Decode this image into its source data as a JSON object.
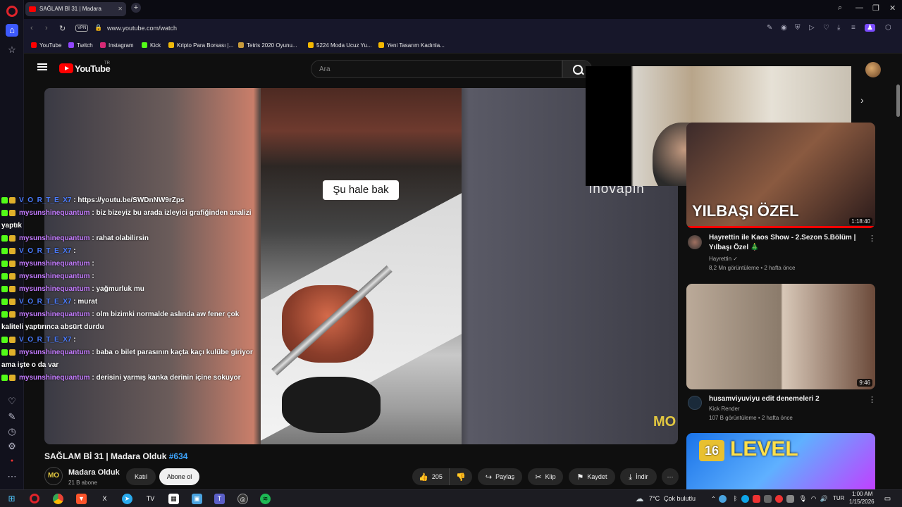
{
  "browser": {
    "tab_title": "SAĞLAM Bİ 31 | Madara",
    "url": "www.youtube.com/watch",
    "vpn": "VPN",
    "bookmarks": [
      "YouTube",
      "Twitch",
      "Instagram",
      "Kick",
      "Kripto Para Borsası |...",
      "Tetris 2020 Oyunu...",
      "5224 Moda Ucuz Yu...",
      "Yeni Tasarım Kadınla..."
    ]
  },
  "youtube": {
    "logo": "YouTube",
    "country": "TR",
    "search_placeholder": "Ara"
  },
  "video": {
    "caption": "Şu hale bak",
    "overlay_brand": "inovapin",
    "watermark": "MO",
    "title": "SAĞLAM Bİ 31 | Madara Olduk",
    "title_tag": "#634",
    "channel_name": "Madara Olduk",
    "channel_logo": "MO",
    "subscribers": "21 B abone",
    "join": "Katıl",
    "subscribe": "Abone ol",
    "likes": "205",
    "share": "Paylaş",
    "clip": "Klip",
    "save": "Kaydet",
    "download": "İndir"
  },
  "chat": [
    {
      "user": "V_O_R_T_E_X7",
      "type": "v",
      "msg": ": https://youtu.be/SWDnNW9rZps"
    },
    {
      "user": "mysunshinequantum",
      "type": "m",
      "msg": ": biz bizeyiz bu arada izleyici grafiğinden analizi"
    },
    {
      "user": "",
      "type": "w",
      "msg": "yaptık"
    },
    {
      "user": "mysunshinequantum",
      "type": "m",
      "msg": ": rahat olabilirsin"
    },
    {
      "user": "V_O_R_T_E_X7",
      "type": "v",
      "msg": ":"
    },
    {
      "user": "mysunshinequantum",
      "type": "m",
      "msg": ":"
    },
    {
      "user": "mysunshinequantum",
      "type": "m",
      "msg": ":"
    },
    {
      "user": "mysunshinequantum",
      "type": "m",
      "msg": ": yağmurluk mu"
    },
    {
      "user": "V_O_R_T_E_X7",
      "type": "v",
      "msg": ": murat"
    },
    {
      "user": "mysunshinequantum",
      "type": "m",
      "msg": ": olm bizimki normalde aslında aw fener çok"
    },
    {
      "user": "",
      "type": "w",
      "msg": "kaliteli yaptırınca absürt durdu"
    },
    {
      "user": "V_O_R_T_E_X7",
      "type": "v",
      "msg": ":"
    },
    {
      "user": "mysunshinequantum",
      "type": "m",
      "msg": ": baba o bilet parasının kaçta kaçı kulübe giriyor"
    },
    {
      "user": "",
      "type": "w",
      "msg": "ama işte o da var"
    },
    {
      "user": "mysunshinequantum",
      "type": "m",
      "msg": ": derisini yarmış kanka derinin içine sokuyor"
    }
  ],
  "recommendations": [
    {
      "title": "Hayrettin ile Kaos Show - 2.Sezon 5.Bölüm | Yılbaşı Özel 🎄",
      "channel": "Hayrettin ✓",
      "meta": "8,2 Mn görüntüleme • 2 hafta önce",
      "duration": "1:18:40",
      "thumb_text": "YILBAŞI ÖZEL"
    },
    {
      "title": "husamviyuviyu edit denemeleri 2",
      "channel": "Kick Render",
      "meta": "107 B görüntüleme • 2 hafta önce",
      "duration": "9:46"
    },
    {
      "thumb_text": "LEVEL",
      "thumb_num": "16"
    }
  ],
  "taskbar": {
    "weather_temp": "7°C",
    "weather_text": "Çok bulutlu",
    "lang": "TUR",
    "time": "1:00 AM",
    "date": "1/15/2026"
  },
  "colors": {
    "accent": "#3d5afe",
    "yt_red": "#ff0000",
    "link": "#3ea6ff"
  }
}
